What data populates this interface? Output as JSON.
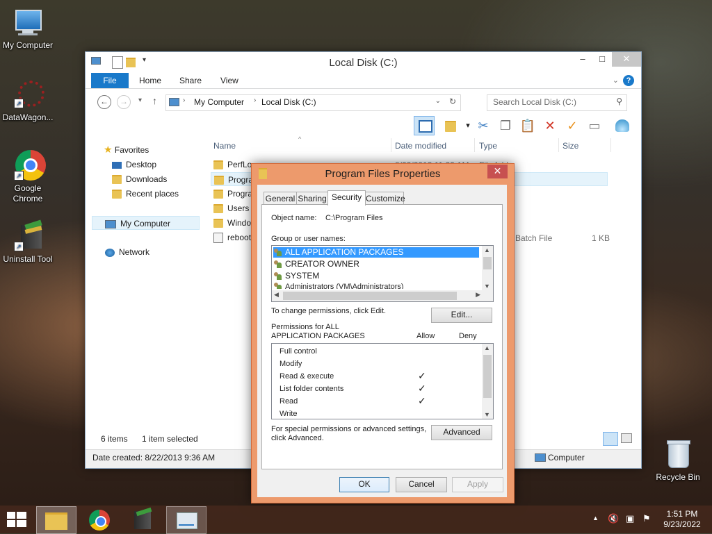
{
  "desktop": {
    "icons": [
      {
        "label": "My Computer"
      },
      {
        "label": "DataWagon..."
      },
      {
        "label": "Google Chrome"
      },
      {
        "label": "Uninstall Tool"
      },
      {
        "label": "Recycle Bin"
      }
    ]
  },
  "explorer": {
    "title": "Local Disk (C:)",
    "window_buttons": {
      "minimize": "–",
      "maximize": "□",
      "close": "✕"
    },
    "ribbon_tabs": [
      "File",
      "Home",
      "Share",
      "View"
    ],
    "breadcrumb": [
      "My Computer",
      "Local Disk (C:)"
    ],
    "search_placeholder": "Search Local Disk (C:)",
    "nav": {
      "favorites": "Favorites",
      "items": [
        "Desktop",
        "Downloads",
        "Recent places"
      ],
      "my_computer": "My Computer",
      "network": "Network"
    },
    "columns": [
      "Name",
      "Date modified",
      "Type",
      "Size"
    ],
    "files": [
      {
        "name": "PerfLo",
        "date": "8/22/2013 11:22 AM",
        "type": "File fold",
        "size": ""
      },
      {
        "name": "Progra",
        "date": "",
        "type": "",
        "size": ""
      },
      {
        "name": "Progra",
        "date": "",
        "type": "",
        "size": ""
      },
      {
        "name": "Users",
        "date": "",
        "type": "",
        "size": ""
      },
      {
        "name": "Windo",
        "date": "",
        "type": "",
        "size": ""
      },
      {
        "name": "reboot",
        "date": "",
        "type": "Batch File",
        "size": "1 KB"
      }
    ],
    "status": {
      "count": "6 items",
      "selected": "1 item selected"
    },
    "details": {
      "date_created": "Date created: 8/22/2013 9:36 AM",
      "location": "Computer"
    }
  },
  "dialog": {
    "title": "Program Files Properties",
    "close": "✕",
    "tabs": [
      "General",
      "Sharing",
      "Security",
      "Customize"
    ],
    "active_tab": "Security",
    "object_name_label": "Object name:",
    "object_name_value": "C:\\Program Files",
    "group_label": "Group or user names:",
    "groups": [
      "ALL APPLICATION PACKAGES",
      "CREATOR OWNER",
      "SYSTEM",
      "Administrators (VM\\Administrators)"
    ],
    "change_text": "To change permissions, click Edit.",
    "edit_button": "Edit...",
    "permissions_label": "Permissions for ALL\nAPPLICATION PACKAGES",
    "allow_label": "Allow",
    "deny_label": "Deny",
    "permissions": [
      {
        "name": "Full control",
        "allow": "",
        "deny": ""
      },
      {
        "name": "Modify",
        "allow": "",
        "deny": ""
      },
      {
        "name": "Read & execute",
        "allow": "✓",
        "deny": ""
      },
      {
        "name": "List folder contents",
        "allow": "✓",
        "deny": ""
      },
      {
        "name": "Read",
        "allow": "✓",
        "deny": ""
      },
      {
        "name": "Write",
        "allow": "",
        "deny": ""
      }
    ],
    "special_text": "For special permissions or advanced settings,\nclick Advanced.",
    "advanced_button": "Advanced",
    "ok": "OK",
    "cancel": "Cancel",
    "apply": "Apply"
  },
  "taskbar": {
    "time": "1:51 PM",
    "date": "9/23/2022"
  },
  "colors": {
    "accent": "#1979ca",
    "dialog_frame": "#ed9a6c",
    "selection": "#3399ff"
  }
}
